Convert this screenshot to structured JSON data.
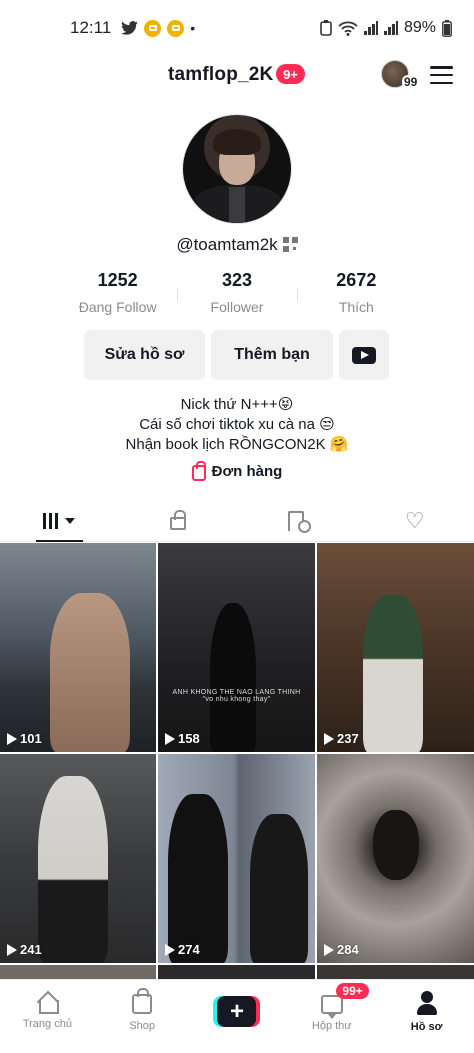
{
  "status_bar": {
    "time": "12:11",
    "battery": "89%"
  },
  "header": {
    "username": "tamflop_2K",
    "notif_badge": "9+",
    "account_count": "99"
  },
  "profile": {
    "handle": "@toamtam2k",
    "stats": [
      {
        "value": "1252",
        "label": "Đang Follow"
      },
      {
        "value": "323",
        "label": "Follower"
      },
      {
        "value": "2672",
        "label": "Thích"
      }
    ],
    "buttons": {
      "edit": "Sửa hồ sơ",
      "add_friend": "Thêm bạn"
    },
    "bio": [
      "Nick thứ N+++😝",
      "Cái số chơi tiktok xu cà na 😒",
      "Nhận book lịch RỒNGCON2K 🤗"
    ],
    "orders_label": "Đơn hàng"
  },
  "videos": [
    {
      "views": "101"
    },
    {
      "views": "158",
      "caption": "ANH KHONG THE NAO LANG THINH",
      "caption2": "\"vo nhu khong thay\""
    },
    {
      "views": "237"
    },
    {
      "views": "241"
    },
    {
      "views": "274"
    },
    {
      "views": "284"
    }
  ],
  "bottom_nav": {
    "home": "Trang chủ",
    "shop": "Shop",
    "inbox": "Hộp thư",
    "inbox_badge": "99+",
    "profile": "Hồ sơ"
  },
  "colors": {
    "accent": "#fe2c55",
    "cyan": "#25f4ee",
    "text": "#161823",
    "muted": "#8a8b91"
  },
  "icons": [
    "twitter-icon",
    "wifi-icon",
    "signal-icon",
    "battery-icon",
    "menu-icon",
    "qr-code-icon",
    "youtube-icon",
    "shopping-bag-icon",
    "grid-icon",
    "lock-icon",
    "saved-icon",
    "liked-icon",
    "play-icon",
    "home-icon",
    "shop-icon",
    "create-icon",
    "inbox-icon",
    "profile-icon"
  ]
}
